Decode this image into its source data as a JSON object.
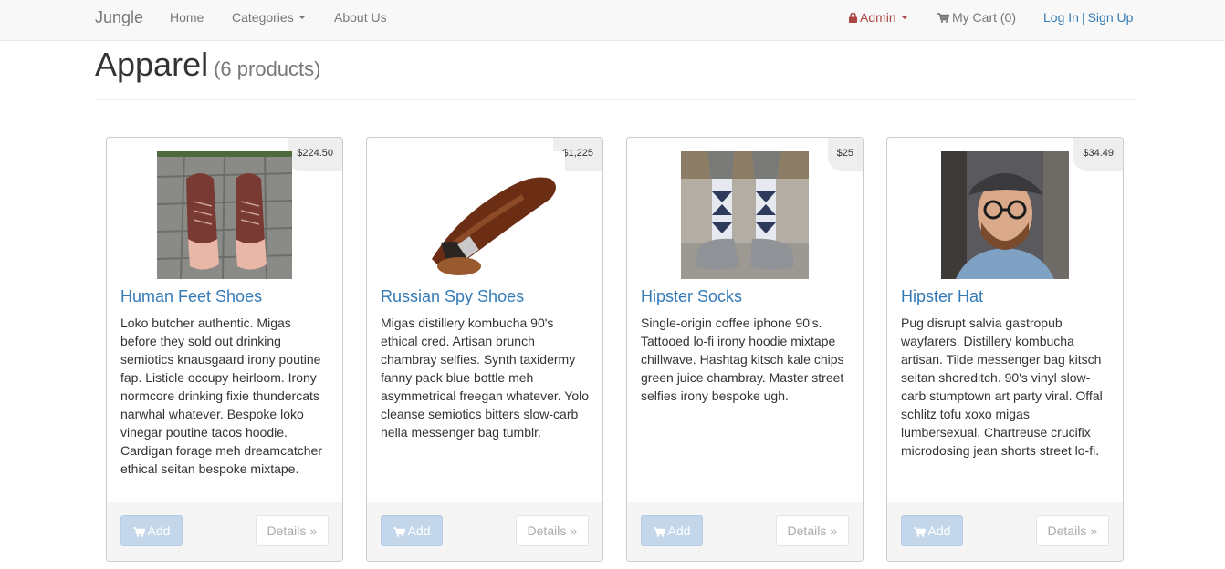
{
  "nav": {
    "brand": "Jungle",
    "home": "Home",
    "categories": "Categories",
    "about": "About Us",
    "admin": "Admin",
    "cart": "My Cart (0)",
    "login": "Log In",
    "separator": "|",
    "signup": "Sign Up"
  },
  "page": {
    "title": "Apparel",
    "count": "(6 products)"
  },
  "colors": {
    "link": "#337ab7",
    "admin": "#a94442",
    "add_button": "#c3d6ea"
  },
  "products": [
    {
      "name": "Human Feet Shoes",
      "price": "$224.50",
      "description": "Loko butcher authentic. Migas before they sold out drinking semiotics knausgaard irony poutine fap. Listicle occupy heirloom. Irony normcore drinking fixie thundercats narwhal whatever. Bespoke loko vinegar poutine tacos hoodie. Cardigan forage meh dreamcatcher ethical seitan bespoke mixtape.",
      "add_label": "Add",
      "details_label": "Details »"
    },
    {
      "name": "Russian Spy Shoes",
      "price": "$1,225",
      "description": "Migas distillery kombucha 90's ethical cred. Artisan brunch chambray selfies. Synth taxidermy fanny pack blue bottle meh asymmetrical freegan whatever. Yolo cleanse semiotics bitters slow-carb hella messenger bag tumblr.",
      "add_label": "Add",
      "details_label": "Details »"
    },
    {
      "name": "Hipster Socks",
      "price": "$25",
      "description": "Single-origin coffee iphone 90's. Tattooed lo-fi irony hoodie mixtape chillwave. Hashtag kitsch kale chips green juice chambray. Master street selfies irony bespoke ugh.",
      "add_label": "Add",
      "details_label": "Details »"
    },
    {
      "name": "Hipster Hat",
      "price": "$34.49",
      "description": "Pug disrupt salvia gastropub wayfarers. Distillery kombucha artisan. Tilde messenger bag kitsch seitan shoreditch. 90's vinyl slow-carb stumptown art party viral. Offal schlitz tofu xoxo migas lumbersexual. Chartreuse crucifix microdosing jean shorts street lo-fi.",
      "add_label": "Add",
      "details_label": "Details »"
    }
  ]
}
